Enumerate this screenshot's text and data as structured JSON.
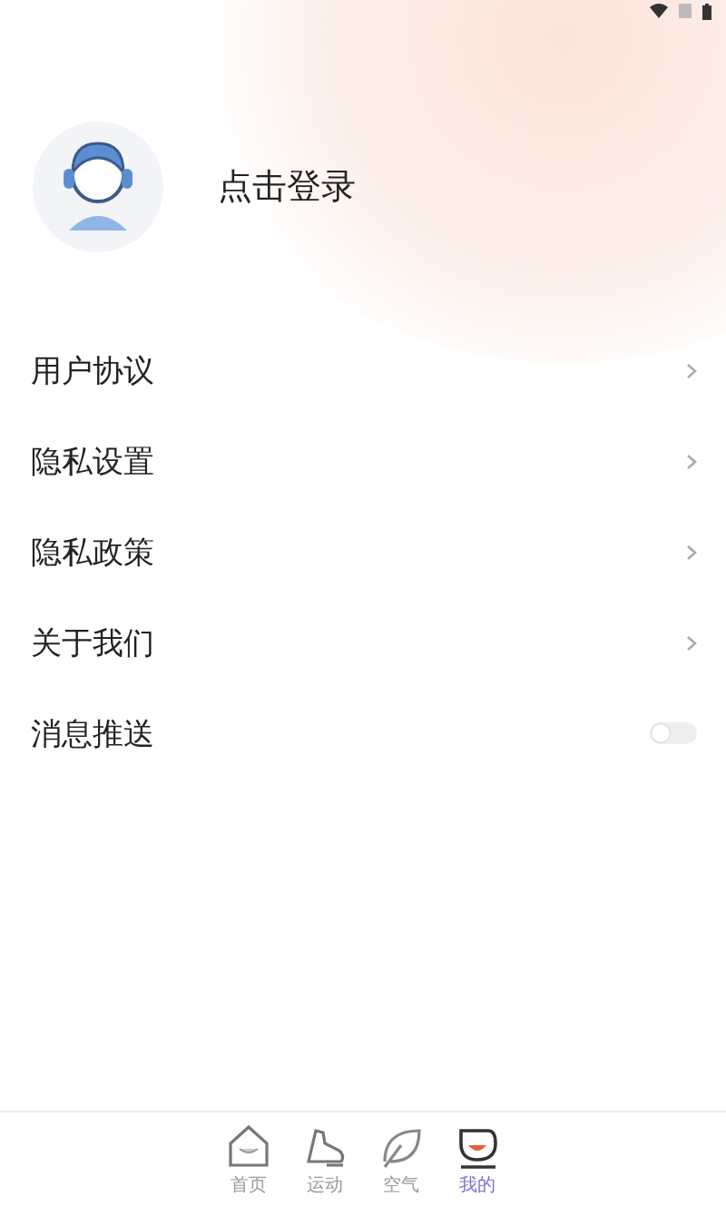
{
  "profile": {
    "login_label": "点击登录"
  },
  "menu": [
    {
      "label": "用户协议",
      "kind": "link"
    },
    {
      "label": "隐私设置",
      "kind": "link"
    },
    {
      "label": "隐私政策",
      "kind": "link"
    },
    {
      "label": "关于我们",
      "kind": "link"
    },
    {
      "label": "消息推送",
      "kind": "toggle",
      "on": false
    }
  ],
  "tabs": [
    {
      "label": "首页",
      "selected": false
    },
    {
      "label": "运动",
      "selected": false
    },
    {
      "label": "空气",
      "selected": false
    },
    {
      "label": "我的",
      "selected": true
    }
  ]
}
